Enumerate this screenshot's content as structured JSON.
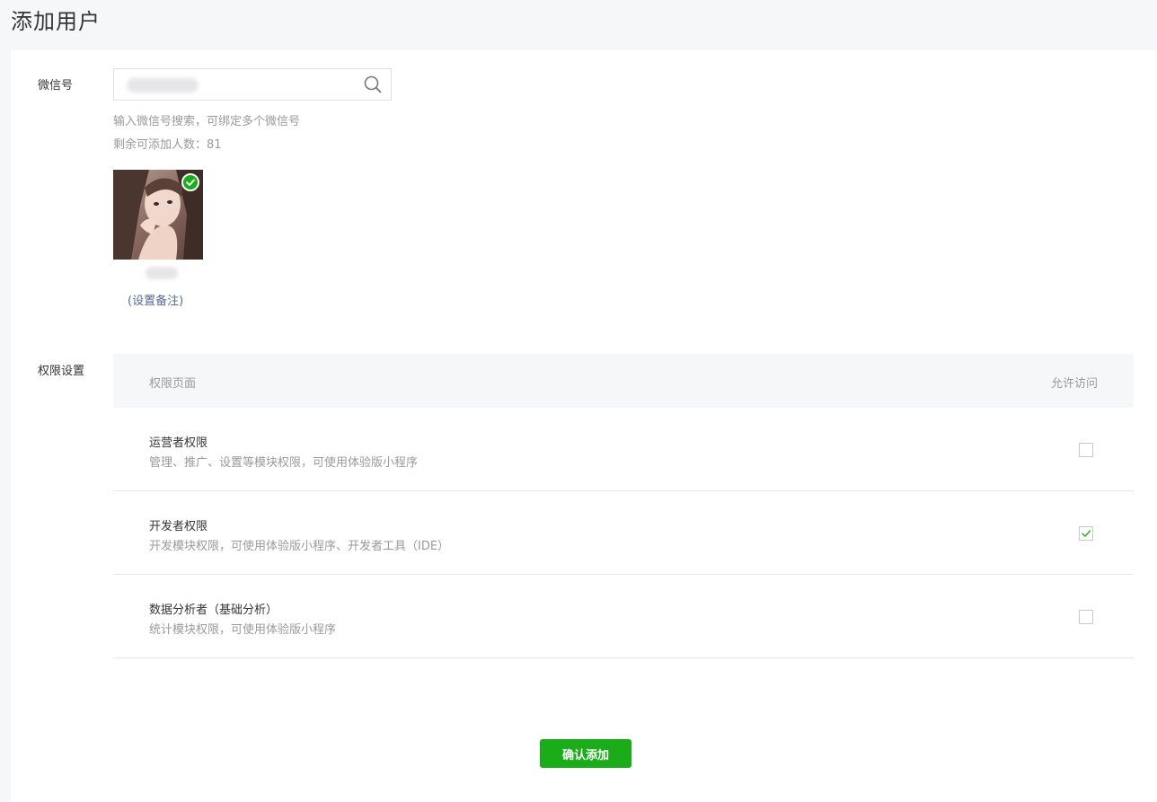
{
  "page": {
    "title": "添加用户"
  },
  "wechat": {
    "label": "微信号",
    "search_value": "",
    "hint": "输入微信号搜索，可绑定多个微信号",
    "remaining": "剩余可添加人数：81"
  },
  "selected_user": {
    "remark_link": "(设置备注)"
  },
  "permissions": {
    "label": "权限设置",
    "col_page": "权限页面",
    "col_allow": "允许访问",
    "rows": [
      {
        "title": "运营者权限",
        "desc": "管理、推广、设置等模块权限，可使用体验版小程序",
        "checked": false
      },
      {
        "title": "开发者权限",
        "desc": "开发模块权限，可使用体验版小程序、开发者工具（IDE）",
        "checked": true
      },
      {
        "title": "数据分析者（基础分析）",
        "desc": "统计模块权限，可使用体验版小程序",
        "checked": false
      }
    ]
  },
  "actions": {
    "confirm_label": "确认添加"
  },
  "colors": {
    "primary": "#1aad19",
    "link": "#576b95"
  },
  "icons": {
    "search": "search-icon",
    "check": "check-icon"
  }
}
